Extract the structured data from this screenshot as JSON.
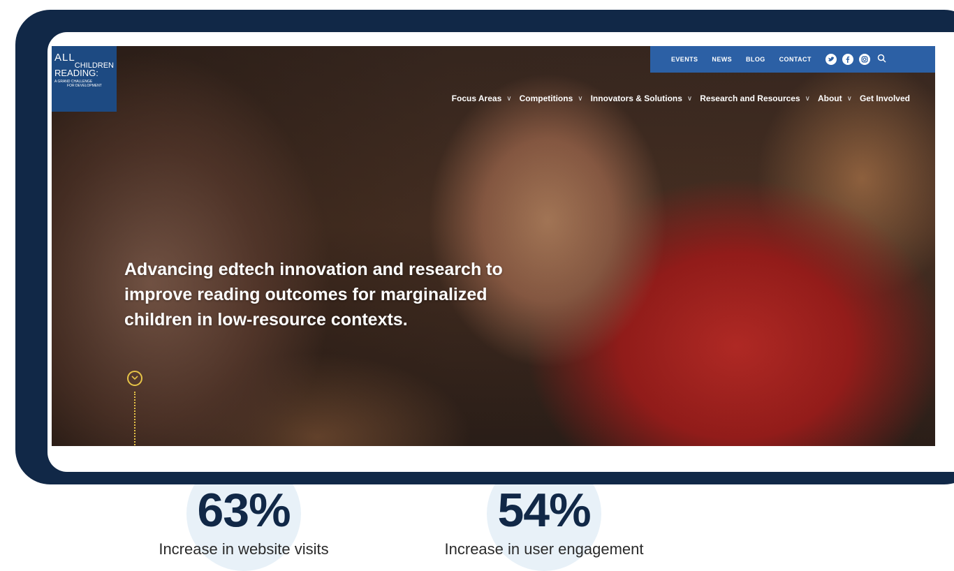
{
  "logo": {
    "line1": "ALL",
    "line2": "CHILDREN",
    "line3": "READING:",
    "tagline_1": "A GRAND CHALLENGE",
    "tagline_2": "FOR DEVELOPMENT"
  },
  "utility_nav": {
    "links": [
      "EVENTS",
      "NEWS",
      "BLOG",
      "CONTACT"
    ],
    "social_icons": [
      "twitter-icon",
      "facebook-icon",
      "instagram-icon"
    ],
    "search_icon": "search-icon"
  },
  "main_nav": {
    "items": [
      {
        "label": "Focus Areas",
        "has_dropdown": true
      },
      {
        "label": "Competitions",
        "has_dropdown": true
      },
      {
        "label": "Innovators & Solutions",
        "has_dropdown": true
      },
      {
        "label": "Research and Resources",
        "has_dropdown": true
      },
      {
        "label": "About",
        "has_dropdown": true
      },
      {
        "label": "Get Involved",
        "has_dropdown": false
      }
    ]
  },
  "hero": {
    "headline_line1": "Advancing edtech innovation and research to",
    "headline_line2": "improve reading outcomes for marginalized",
    "headline_line3": "children in low-resource contexts.",
    "scroll_icon": "chevron-down-icon"
  },
  "stats": [
    {
      "value": "63%",
      "label": "Increase in website visits"
    },
    {
      "value": "54%",
      "label": "Increase in user engagement"
    }
  ],
  "colors": {
    "frame": "#112847",
    "brand_blue": "#2c60a5",
    "logo_blue": "#1d4a82",
    "accent_gold": "#e7c447",
    "bubble": "#e8f1f8"
  }
}
